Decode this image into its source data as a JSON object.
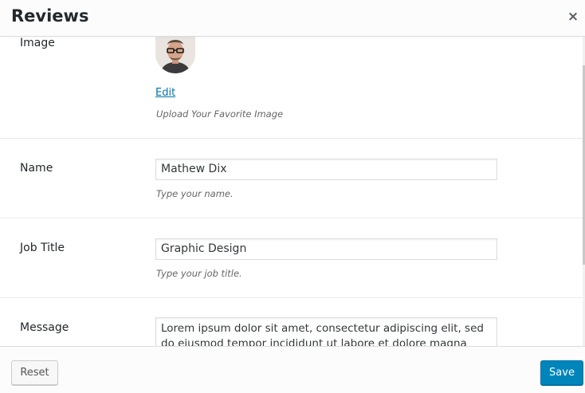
{
  "modal": {
    "title": "Reviews",
    "close_icon": "×"
  },
  "fields": {
    "image": {
      "label": "Image",
      "edit_label": "Edit",
      "description": "Upload Your Favorite Image"
    },
    "name": {
      "label": "Name",
      "value": "Mathew Dix",
      "description": "Type your name."
    },
    "job_title": {
      "label": "Job Title",
      "value": "Graphic Design",
      "description": "Type your job title."
    },
    "message": {
      "label": "Message",
      "value": "Lorem ipsum dolor sit amet, consectetur adipiscing elit, sed do eiusmod tempor incididunt ut labore et dolore magna aliqua."
    }
  },
  "footer": {
    "reset_label": "Reset",
    "save_label": "Save"
  },
  "colors": {
    "primary": "#0085ba",
    "link": "#0073aa"
  }
}
